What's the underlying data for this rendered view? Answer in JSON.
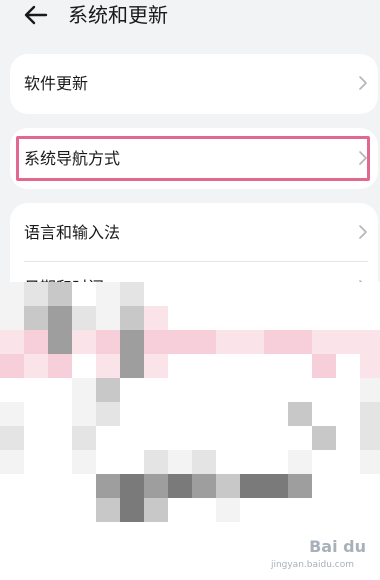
{
  "header": {
    "title": "系统和更新",
    "back_icon": "arrow-left-icon"
  },
  "settings": {
    "card_1": {
      "items": [
        {
          "label": "软件更新",
          "icon": "chevron-right-icon"
        }
      ]
    },
    "card_2": {
      "items": [
        {
          "label": "系统导航方式",
          "icon": "chevron-right-icon",
          "highlighted": true
        }
      ]
    },
    "card_3": {
      "items": [
        {
          "label": "语言和输入法",
          "icon": "chevron-right-icon"
        },
        {
          "label": "日期和时间",
          "icon": "chevron-right-icon"
        }
      ]
    }
  },
  "colors": {
    "background": "#f1f3f5",
    "card": "#ffffff",
    "highlight": "#e2688f",
    "chevron": "#b5b5b5"
  },
  "watermark": {
    "brand": "Bai du",
    "sub": "jingyan.baidu.com"
  }
}
